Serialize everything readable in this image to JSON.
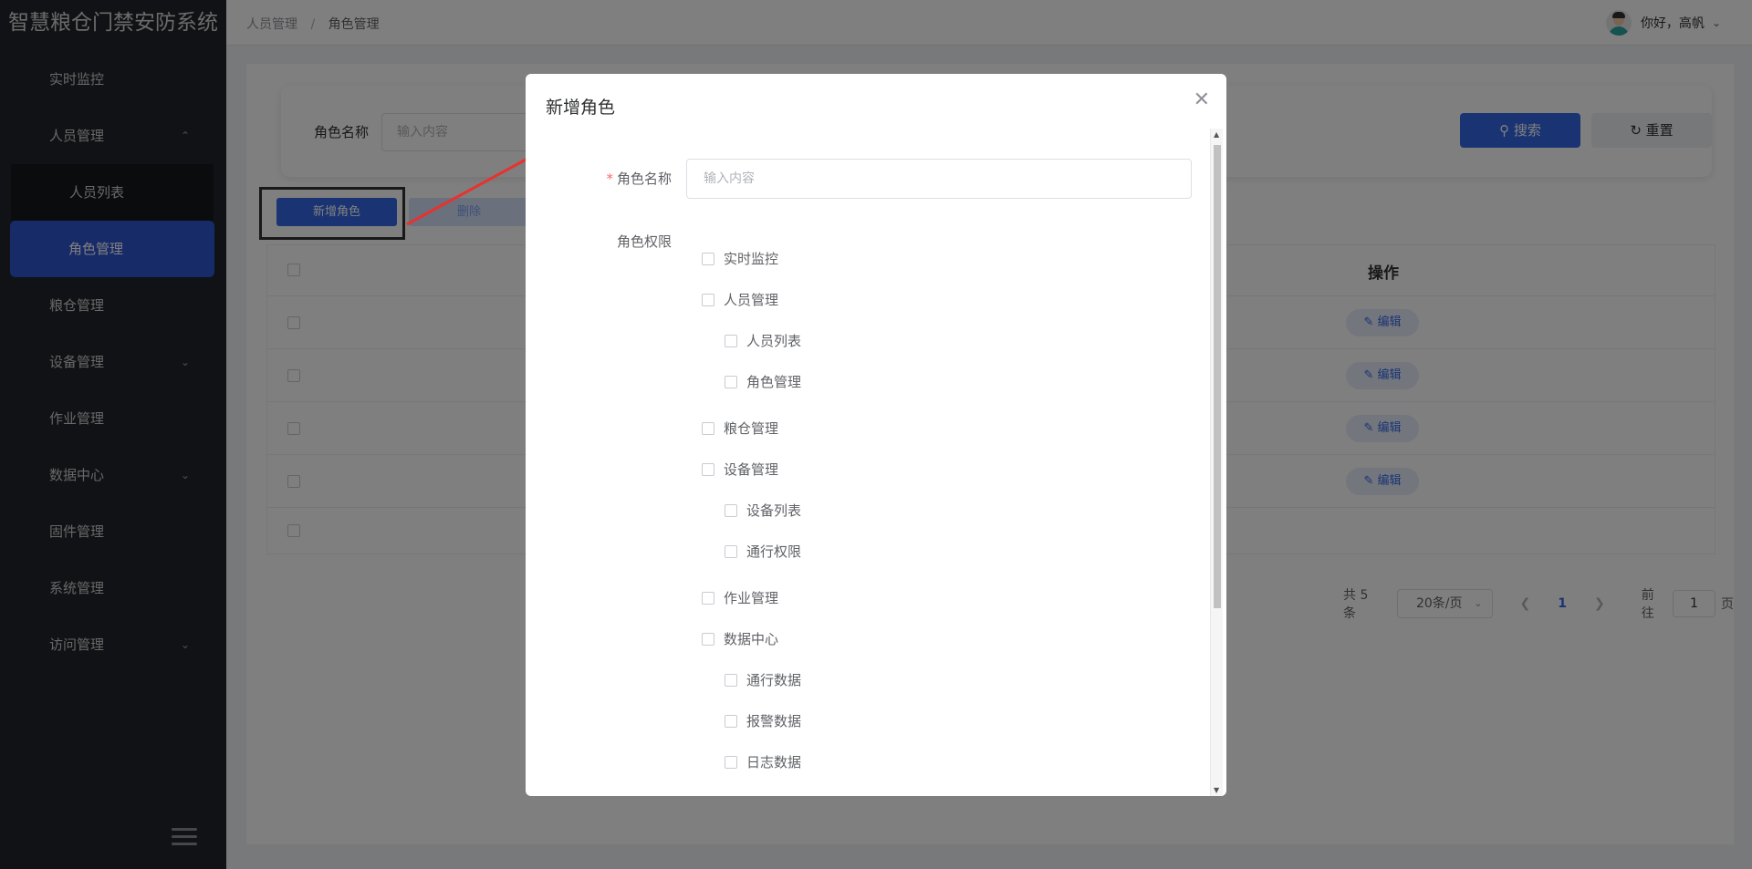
{
  "app": {
    "title": "智慧粮仓门禁安防系统"
  },
  "sidebar": {
    "items": [
      {
        "label": "实时监控"
      },
      {
        "label": "人员管理",
        "chevron": "^"
      },
      {
        "label": "粮仓管理"
      },
      {
        "label": "设备管理",
        "chevron": "v"
      },
      {
        "label": "作业管理"
      },
      {
        "label": "数据中心",
        "chevron": "v"
      },
      {
        "label": "固件管理"
      },
      {
        "label": "系统管理"
      },
      {
        "label": "访问管理",
        "chevron": "v"
      }
    ],
    "sub_items": [
      {
        "label": "人员列表"
      },
      {
        "label": "角色管理"
      }
    ],
    "collapse_icon": "menu-fold-icon"
  },
  "header": {
    "breadcrumb": [
      "人员管理",
      "/",
      "角色管理"
    ],
    "greeting": "你好，高帆"
  },
  "search": {
    "label": "角色名称",
    "placeholder": "输入内容",
    "search_button": "搜索",
    "reset_button": "重置"
  },
  "toolbar": {
    "add_button": "新增角色",
    "delete_button": "删除"
  },
  "table": {
    "op_header": "操作",
    "edit_label": "编辑"
  },
  "pagination": {
    "total": "共 5 条",
    "page_size": "20条/页",
    "current_page": "1",
    "goto_prefix": "前往",
    "goto_value": "1",
    "goto_suffix": "页"
  },
  "dialog": {
    "title": "新增角色",
    "name_label": "角色名称",
    "name_placeholder": "输入内容",
    "perm_label": "角色权限",
    "permissions": [
      "实时监控",
      "人员管理",
      "人员列表",
      "角色管理",
      "粮仓管理",
      "设备管理",
      "设备列表",
      "通行权限",
      "作业管理",
      "数据中心",
      "通行数据",
      "报警数据",
      "日志数据"
    ]
  },
  "colors": {
    "sidebar_bg": "#22252b",
    "accent": "#3569e6",
    "annotation_arrow": "#e8322f"
  }
}
